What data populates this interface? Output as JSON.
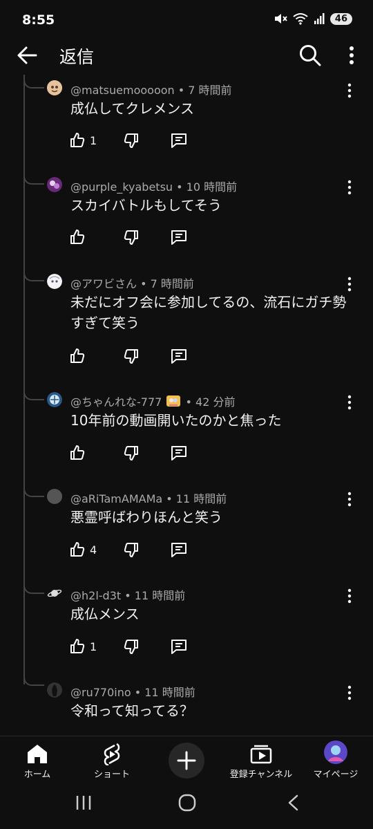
{
  "status": {
    "time": "8:55",
    "battery": "46"
  },
  "header": {
    "title": "返信"
  },
  "comments": [
    {
      "author": "@matsuemooooon",
      "time": "7 時間前",
      "text": "成仏してクレメンス",
      "likes": "1"
    },
    {
      "author": "@purple_kyabetsu",
      "time": "10 時間前",
      "text": "スカイバトルもしてそう",
      "likes": ""
    },
    {
      "author": "@アワビさん",
      "time": "7 時間前",
      "text": "未だにオフ会に参加してるの、流石にガチ勢すぎて笑う",
      "likes": ""
    },
    {
      "author": "@ちゃんれな-777",
      "time": "42 分前",
      "text": "10年前の動画開いたのかと焦った",
      "likes": ""
    },
    {
      "author": "@aRiTamAMAMa",
      "time": "11 時間前",
      "text": "悪霊呼ばわりほんと笑う",
      "likes": "4"
    },
    {
      "author": "@h2l-d3t",
      "time": "11 時間前",
      "text": "成仏メンス",
      "likes": "1"
    },
    {
      "author": "@ru770ino",
      "time": "11 時間前",
      "text": "令和って知ってる？",
      "likes": ""
    }
  ],
  "nav": {
    "home": "ホーム",
    "shorts": "ショート",
    "subscriptions": "登録チャンネル",
    "mypage": "マイページ"
  }
}
